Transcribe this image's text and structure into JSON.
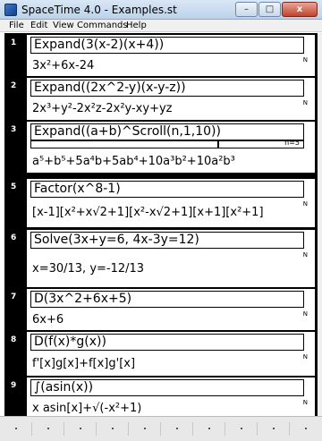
{
  "window": {
    "title": "SpaceTime 4.0 - Examples.st",
    "min": "–",
    "max": "□",
    "close": "x"
  },
  "menu": [
    "File",
    "Edit",
    "View",
    "Commands",
    "Help"
  ],
  "flag": "N",
  "cells": [
    {
      "num": "1",
      "input": "Expand(3(x-2)(x+4))",
      "output": "3x²+6x-24"
    },
    {
      "num": "2",
      "input": "Expand((2x^2-y)(x-y-z))",
      "output": "2x³+y²-2x²z-2x²y-xy+yz"
    },
    {
      "num": "3",
      "input": "Expand((a+b)^Scroll(n,1,10))",
      "scroll_label": "n=5",
      "output": "a⁵+b⁵+5a⁴b+5ab⁴+10a³b²+10a²b³"
    },
    {
      "num": "5",
      "input": "Factor(x^8-1)",
      "output": "[x-1][x²+x√2+1][x²-x√2+1][x+1][x²+1]"
    },
    {
      "num": "6",
      "input": "Solve(3x+y=6, 4x-3y=12)",
      "output": "x=30/13, y=-12/13"
    },
    {
      "num": "7",
      "input": "D(3x^2+6x+5)",
      "output": "6x+6"
    },
    {
      "num": "8",
      "input": "D(f(x)*g(x))",
      "output": "f'[x]g[x]+f[x]g'[x]"
    },
    {
      "num": "9",
      "input": "∫(asin(x))",
      "output": "x asin[x]+√(-x²+1)"
    }
  ]
}
